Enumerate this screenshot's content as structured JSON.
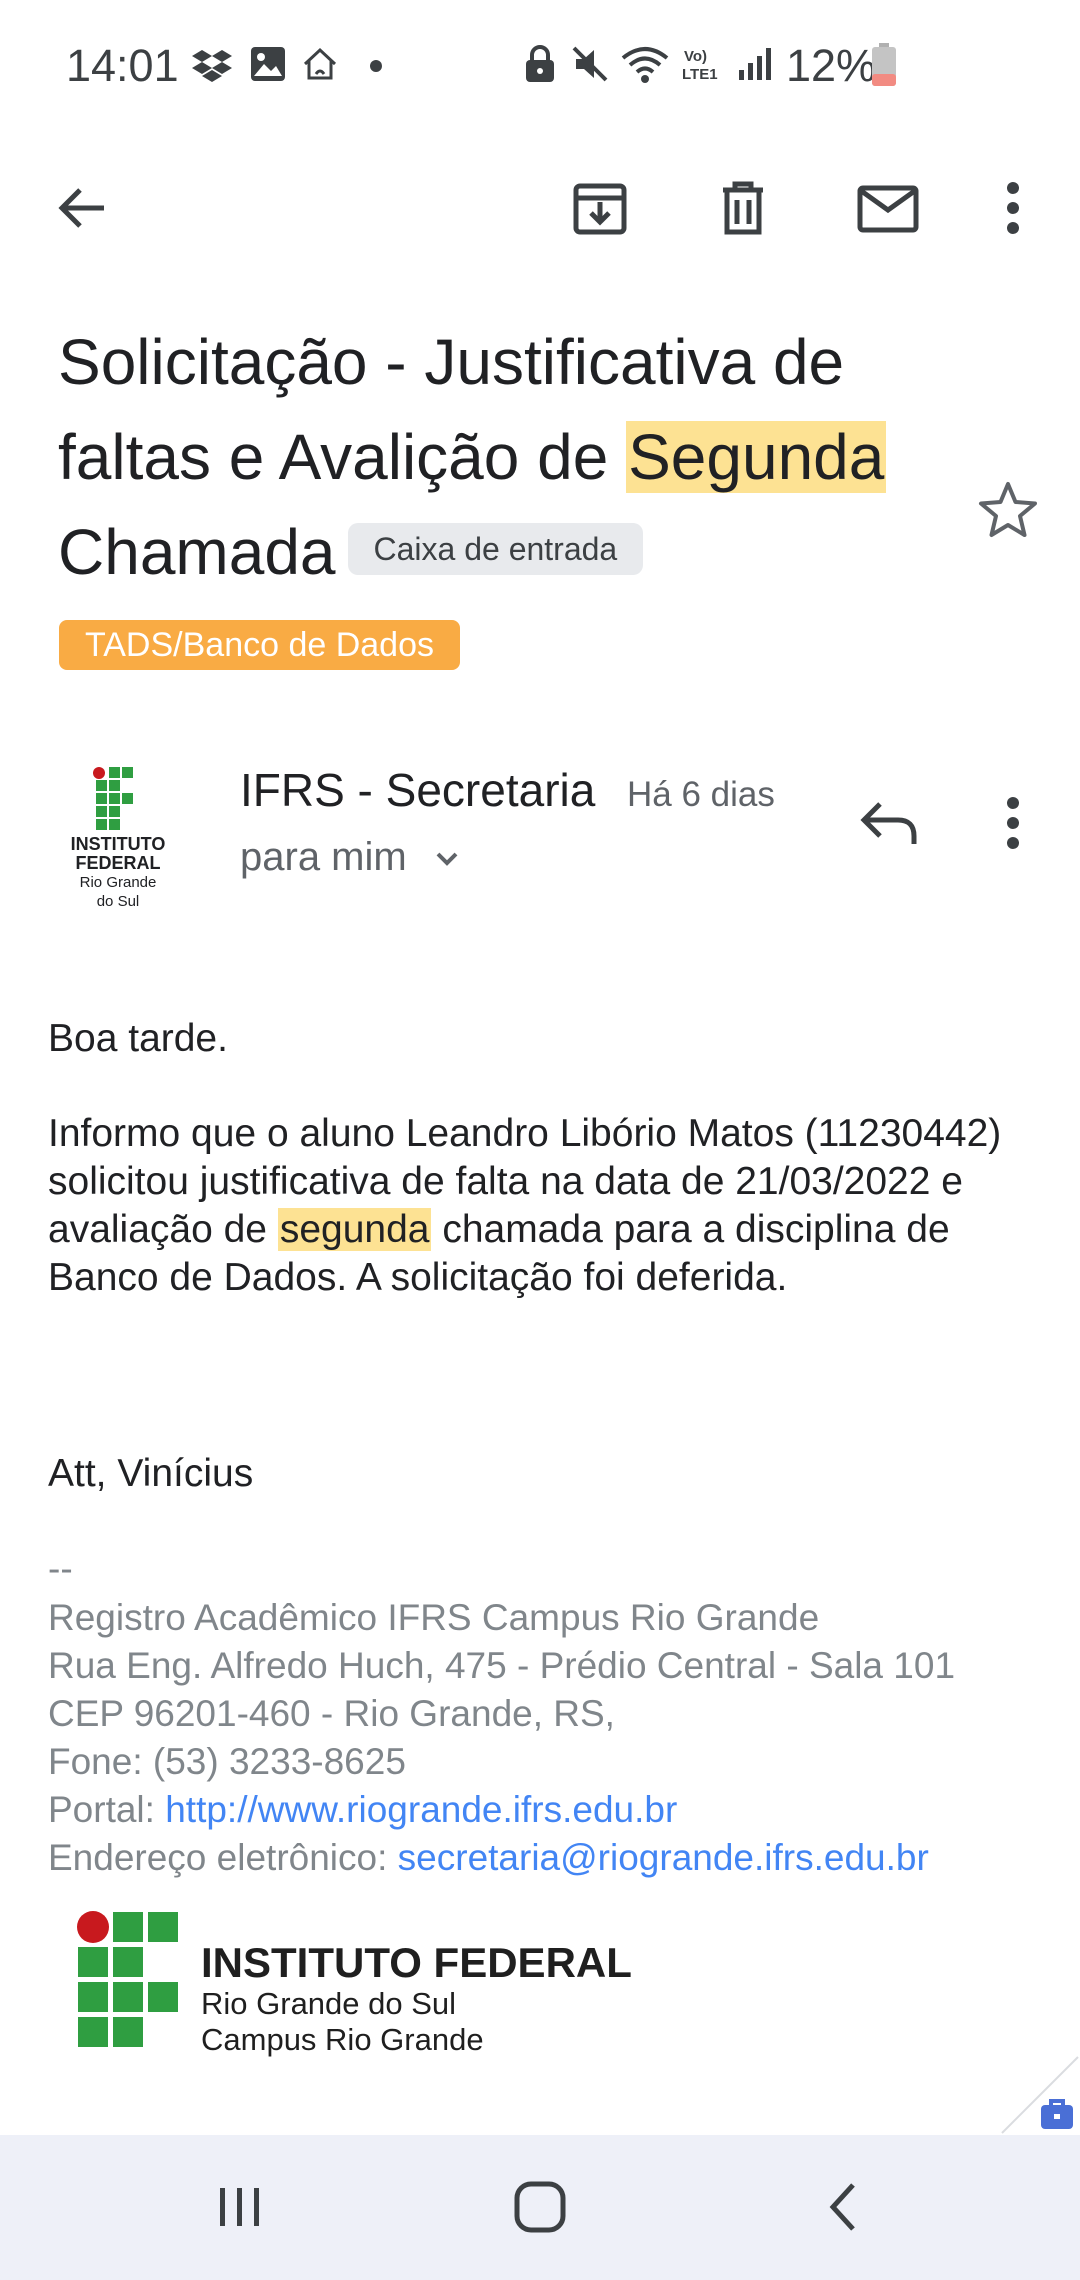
{
  "status_bar": {
    "time": "14:01",
    "battery": "12%",
    "icons": [
      "dropbox-icon",
      "gallery-icon",
      "home-icon",
      "dot-icon",
      "lock-icon",
      "mute-icon",
      "wifi-icon",
      "volte-lte-icon",
      "signal-icon",
      "battery-icon"
    ],
    "volte": "Vo) LTE1"
  },
  "toolbar": {
    "icons": [
      "back-arrow-icon",
      "archive-icon",
      "delete-icon",
      "mail-unread-icon",
      "more-vert-icon"
    ]
  },
  "email": {
    "subject_part1": "Solicitação - Justificativa de faltas e Avalição de ",
    "subject_highlight": "Segunda",
    "subject_part2": " Chamada",
    "inbox_label": "Caixa de entrada",
    "category_label": "TADS/Banco de Dados",
    "sender": {
      "name": "IFRS - Secretaria",
      "time": "Há 6 dias",
      "recipient": "para mim",
      "logo_line1": "INSTITUTO",
      "logo_line2": "FEDERAL",
      "logo_line3": "Rio Grande",
      "logo_line4": "do Sul"
    },
    "body": {
      "greeting": "Boa tarde.",
      "para_part1": "Informo que o aluno Leandro Libório Matos (11230442) solicitou justificativa de falta na data de 21/03/2022 e avaliação de ",
      "para_highlight": "segunda",
      "para_part2": " chamada para a disciplina de Banco de Dados. A solicitação foi deferida.",
      "closing": "Att, Vinícius"
    },
    "signature": {
      "separator": "--",
      "line1": "Registro Acadêmico IFRS Campus Rio Grande",
      "line2": "Rua Eng. Alfredo Huch, 475 - Prédio Central - Sala 101",
      "line3": "CEP 96201-460 - Rio Grande, RS,",
      "line4": "Fone: (53) 3233-8625",
      "portal_label": "Portal: ",
      "portal_url": "http://www.riogrande.ifrs.edu.br",
      "email_label": "Endereço eletrônico: ",
      "email_address": "secretaria@riogrande.ifrs.edu.br"
    },
    "footer_logo": {
      "line1": "INSTITUTO FEDERAL",
      "line2": "Rio Grande do Sul",
      "line3": "Campus Rio Grande"
    }
  },
  "nav_bar": {
    "icons": [
      "recent-apps-icon",
      "home-button-icon",
      "back-nav-icon"
    ]
  },
  "colors": {
    "highlight": "#fde293",
    "label_chip": "#f9ab44",
    "ifrs_green": "#2f9e41",
    "ifrs_red": "#c8191e",
    "link": "#4285f4"
  }
}
